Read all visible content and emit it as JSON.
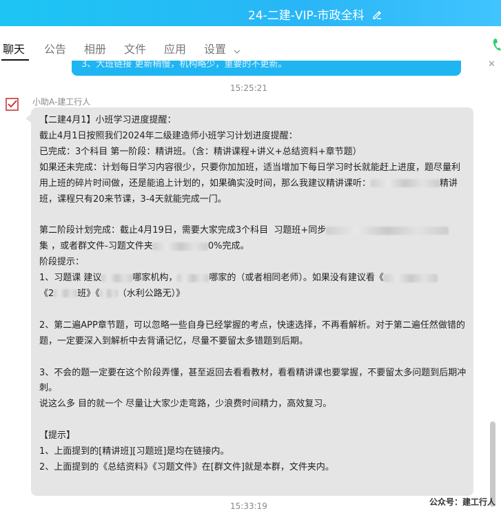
{
  "window": {
    "title": "24-二建-VIP-市政全科",
    "accent": "#1fb5f2"
  },
  "tabs": [
    {
      "label": "聊天",
      "active": true
    },
    {
      "label": "公告"
    },
    {
      "label": "相册"
    },
    {
      "label": "文件"
    },
    {
      "label": "应用"
    },
    {
      "label": "设置"
    }
  ],
  "chat": {
    "previous_message_fragment": "3、大班链接 更新稍慢，机构略少，重要的不更新。",
    "time_1": "15:25:21",
    "sender": "小助A-建工行人",
    "lines": [
      "【二建4月1】小班学习进度提醒：",
      "截止4月1日按照我们2024年二级建造师小班学习计划进度提醒：",
      "已完成：3个科目 第一阶段：精讲班。（含：精讲课程+讲义+总结资料+章节题）",
      "如果还未完成：计划每日学习内容很少，只要你加加班，适当增加下每日学习时长就能赶上进度，题尽量利用上班的碎片时间做，还是能追上计划的，如果确实没时间，那么我建议精讲课听：",
      "精讲班，课程只有20来节课，3-4天就能完成一门。",
      "第二阶段计划完成：截止4月19日，需要大家完成3个科目  习题班+同步",
      "集 ，或者群文件-习题文件夹",
      "0%完成。",
      "阶段提示：",
      "1、习题课 建议",
      "哪家机构，",
      "哪家的（或者相同老师）。如果没有建议看《",
      "《2",
      "班》《",
      "（水利公路无）》",
      "2、第二遍APP章节题，可以忽略一些自身已经掌握的考点，快速选择，不再看解析。对于第二遍任然做错的题，一定要深入到解析中去背诵记忆，尽量不要留太多错题到后期。",
      "3、不会的题一定要在这个阶段弄懂，甚至返回去看看教材，看看精讲课也要掌握，不要留太多问题到后期冲刺。",
      "说这么多 目的就一个 尽量让大家少走弯路，少浪费时间精力，高效复习。",
      "【提示】",
      "1、上面提到的[精讲班][习题班]是均在链接内。",
      "2、上面提到的《总结资料》《习题文件》在[群文件]就是本群，文件夹内。"
    ],
    "time_2": "15:33:19"
  },
  "watermark": "公众号：建工行人",
  "icons": {
    "edit": "pencil-icon",
    "settings_dropdown": "chevron-down-icon",
    "call": "phone-icon",
    "avatar": "checkbox-avatar-icon",
    "close": "close-icon"
  }
}
